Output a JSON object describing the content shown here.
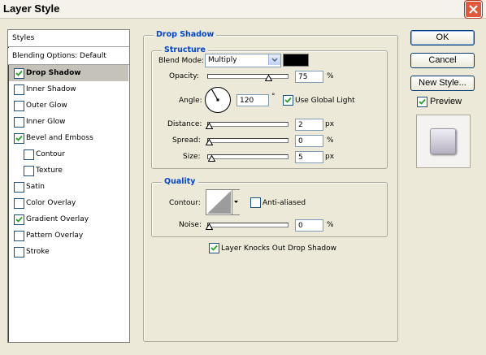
{
  "window": {
    "title": "Layer Style"
  },
  "styles_list": {
    "header": "Styles",
    "blending": "Blending Options: Default",
    "items": [
      {
        "label": "Drop Shadow",
        "checked": true,
        "selected": true,
        "indent": false
      },
      {
        "label": "Inner Shadow",
        "checked": false,
        "selected": false,
        "indent": false
      },
      {
        "label": "Outer Glow",
        "checked": false,
        "selected": false,
        "indent": false
      },
      {
        "label": "Inner Glow",
        "checked": false,
        "selected": false,
        "indent": false
      },
      {
        "label": "Bevel and Emboss",
        "checked": true,
        "selected": false,
        "indent": false
      },
      {
        "label": "Contour",
        "checked": false,
        "selected": false,
        "indent": true
      },
      {
        "label": "Texture",
        "checked": false,
        "selected": false,
        "indent": true
      },
      {
        "label": "Satin",
        "checked": false,
        "selected": false,
        "indent": false
      },
      {
        "label": "Color Overlay",
        "checked": false,
        "selected": false,
        "indent": false
      },
      {
        "label": "Gradient Overlay",
        "checked": true,
        "selected": false,
        "indent": false
      },
      {
        "label": "Pattern Overlay",
        "checked": false,
        "selected": false,
        "indent": false
      },
      {
        "label": "Stroke",
        "checked": false,
        "selected": false,
        "indent": false
      }
    ]
  },
  "drop_shadow": {
    "title": "Drop Shadow",
    "structure": {
      "title": "Structure",
      "blend_mode_label": "Blend Mode:",
      "blend_mode_value": "Multiply",
      "shadow_color": "#000000",
      "opacity_label": "Opacity:",
      "opacity_value": "75",
      "opacity_unit": "%",
      "opacity_fraction": 0.75,
      "angle_label": "Angle:",
      "angle_value": "120",
      "angle_unit": "°",
      "use_global_light_label": "Use Global Light",
      "use_global_light_checked": true,
      "distance_label": "Distance:",
      "distance_value": "2",
      "distance_unit": "px",
      "spread_label": "Spread:",
      "spread_value": "0",
      "spread_unit": "%",
      "size_label": "Size:",
      "size_value": "5",
      "size_unit": "px"
    },
    "quality": {
      "title": "Quality",
      "contour_label": "Contour:",
      "anti_aliased_label": "Anti-aliased",
      "anti_aliased_checked": false,
      "noise_label": "Noise:",
      "noise_value": "0",
      "noise_unit": "%"
    },
    "knocks_out_label": "Layer Knocks Out Drop Shadow",
    "knocks_out_checked": true
  },
  "buttons": {
    "ok": "OK",
    "cancel": "Cancel",
    "new_style": "New Style...",
    "preview_label": "Preview",
    "preview_checked": true
  },
  "colors": {
    "accent": "#0046d5",
    "background": "#ece9d8",
    "close": "#e3573b"
  }
}
